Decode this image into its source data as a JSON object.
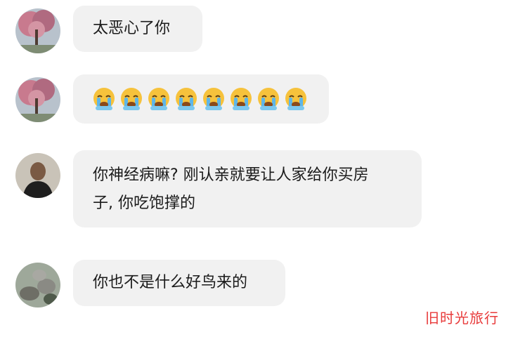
{
  "messages": [
    {
      "sender_avatar": "tree-blossom-avatar",
      "text": "太恶心了你"
    },
    {
      "sender_avatar": "tree-blossom-avatar",
      "emoji": "crying-face-icon",
      "emoji_count": 8
    },
    {
      "sender_avatar": "man-dark-avatar",
      "text": "你神经病嘛? 刚认亲就要让人家给你买房\n子, 你吃饱撑的"
    },
    {
      "sender_avatar": "stones-avatar",
      "text": "你也不是什么好鸟来的"
    }
  ],
  "watermark": "旧时光旅行",
  "colors": {
    "bubble_bg": "#f1f1f1",
    "page_bg": "#ffffff",
    "text": "#1b1b1b",
    "watermark": "#e83a3a"
  }
}
